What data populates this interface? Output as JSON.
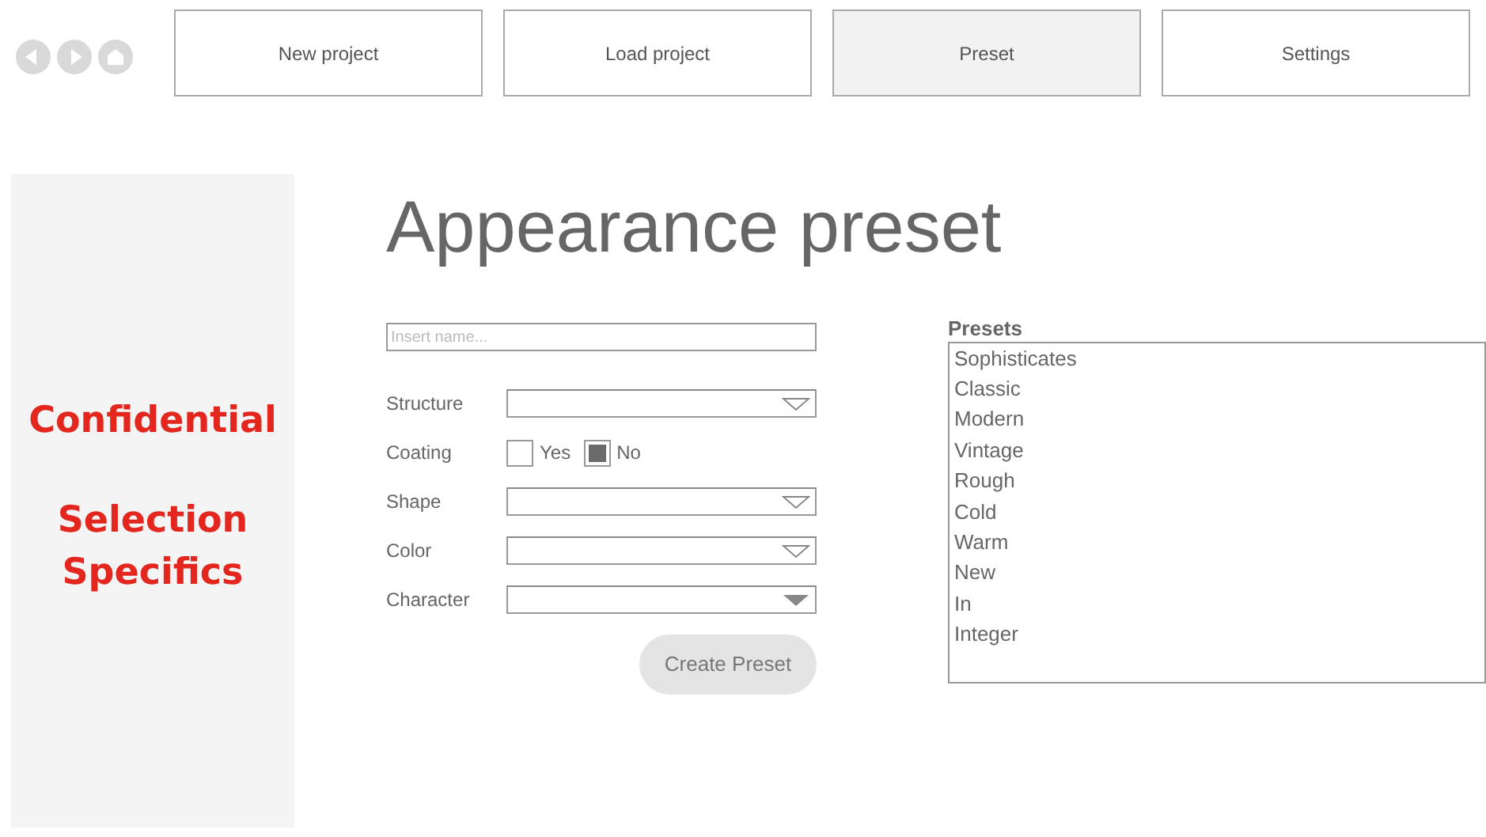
{
  "nav_buttons": [
    {
      "label": "New project",
      "selected": false
    },
    {
      "label": "Load project",
      "selected": false
    },
    {
      "label": "Preset",
      "selected": true
    },
    {
      "label": "Settings",
      "selected": false
    }
  ],
  "sidebar": {
    "items": [
      "Confidential",
      "Selection Specifics"
    ]
  },
  "title": "Appearance preset",
  "name_field": {
    "placeholder": "Insert name..."
  },
  "fields": [
    {
      "kind": "dropdown",
      "label": "Structure",
      "arrow_filled": false
    },
    {
      "kind": "checkboxes",
      "label": "Coating",
      "options": [
        {
          "label": "Yes",
          "checked": false
        },
        {
          "label": "No",
          "checked": true
        }
      ]
    },
    {
      "kind": "dropdown",
      "label": "Shape",
      "arrow_filled": false
    },
    {
      "kind": "dropdown",
      "label": "Color",
      "arrow_filled": false
    },
    {
      "kind": "dropdown",
      "label": "Character",
      "arrow_filled": true
    }
  ],
  "create_button": "Create Preset",
  "presets": {
    "title": "Presets",
    "items": [
      "Sophisticates",
      "Classic",
      "Modern",
      "Vintage",
      "Rough",
      "Cold",
      "Warm",
      "New",
      "In",
      "Integer"
    ]
  }
}
